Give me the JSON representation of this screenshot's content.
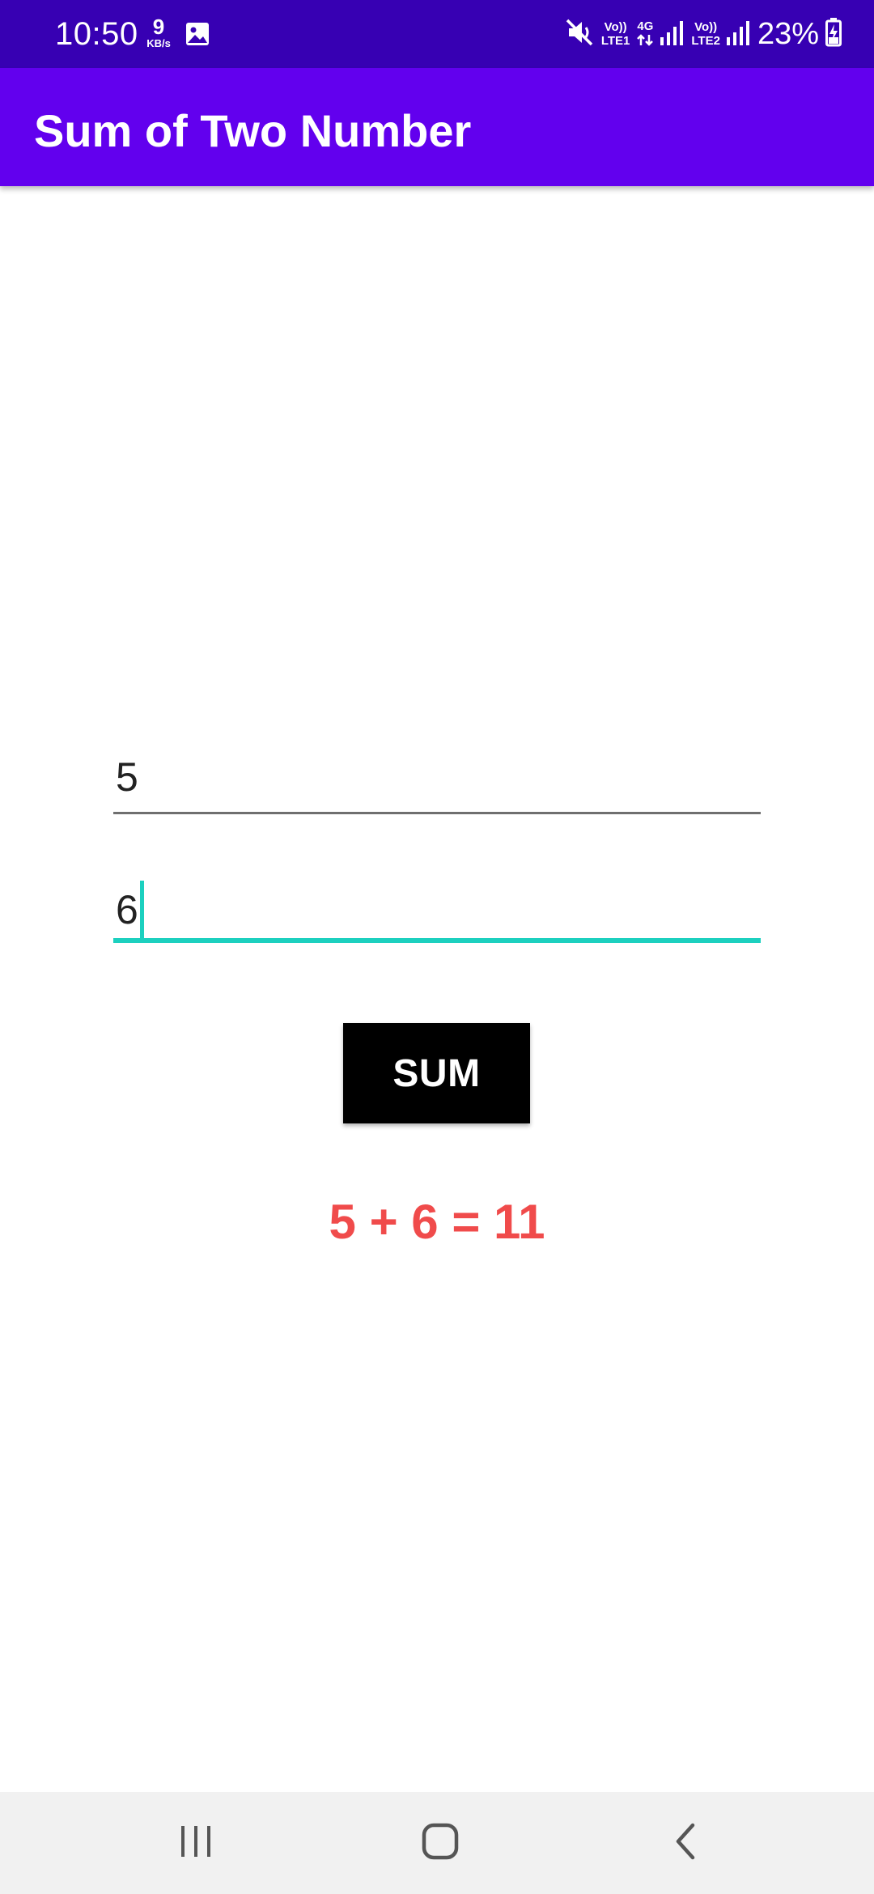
{
  "status_bar": {
    "time": "10:50",
    "net_speed_value": "9",
    "net_speed_unit": "KB/s",
    "sim1_top": "Vo))",
    "sim1_bottom": "LTE1",
    "data_type": "4G",
    "sim2_top": "Vo))",
    "sim2_bottom": "LTE2",
    "battery": "23%",
    "icons": [
      "gallery-icon",
      "mute-icon",
      "data-arrows-icon",
      "signal-icon",
      "battery-charging-icon"
    ]
  },
  "app_bar": {
    "title": "Sum of Two Number",
    "color": "#6200ee"
  },
  "form": {
    "first_number": "5",
    "second_number": "6",
    "focused_accent": "#1cd0bf"
  },
  "button": {
    "label": "SUM"
  },
  "result": {
    "text": "5 + 6 = 11",
    "color": "#f04b4b"
  },
  "nav_bar": {
    "icons": [
      "recents-icon",
      "home-icon",
      "back-icon"
    ]
  }
}
